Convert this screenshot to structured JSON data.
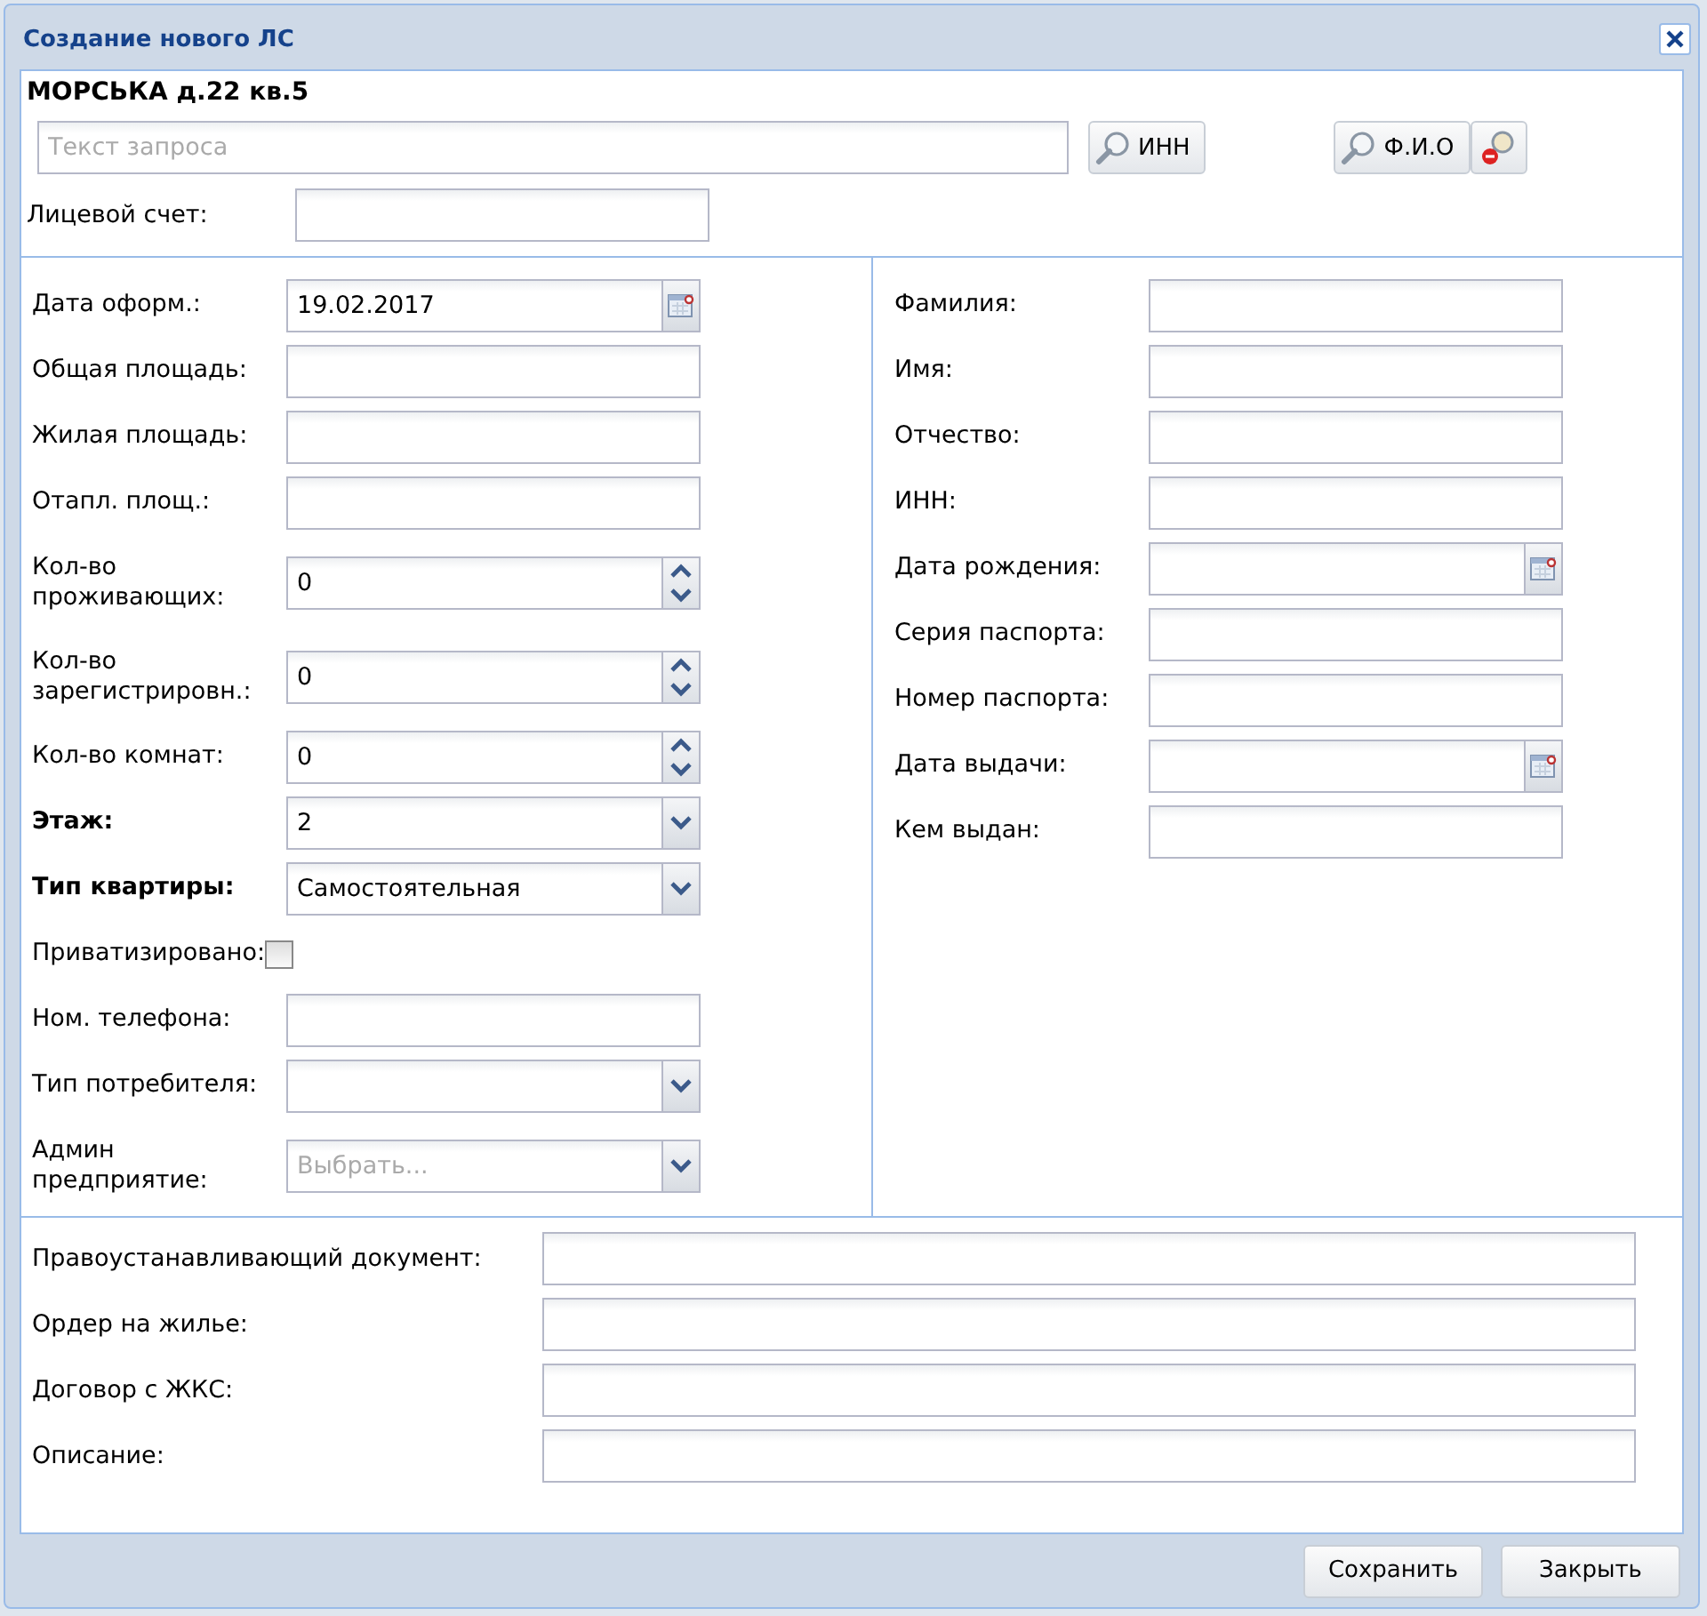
{
  "window": {
    "title": "Создание нового ЛС"
  },
  "address": "МОРСЬКА д.22 кв.5",
  "search": {
    "placeholder": "Текст запроса",
    "buttons": [
      {
        "label": "ИНН"
      },
      {
        "label": "Ф.И.О"
      }
    ]
  },
  "account": {
    "label": "Лицевой счет:"
  },
  "left_fields": [
    {
      "kind": "date",
      "label": "Дата оформ.:",
      "value": "19.02.2017",
      "required": false
    },
    {
      "kind": "text",
      "label": "Общая площадь:",
      "required": false
    },
    {
      "kind": "text",
      "label": "Жилая площадь:",
      "required": false
    },
    {
      "kind": "text",
      "label": "Отапл. площ.:",
      "required": false
    },
    {
      "kind": "spinner",
      "label": "Кол-во проживающих:",
      "value": "0",
      "required": false
    },
    {
      "kind": "spinner",
      "label": "Кол-во зарегистрировн.:",
      "value": "0",
      "required": false
    },
    {
      "kind": "spinner",
      "label": "Кол-во комнат:",
      "value": "0",
      "required": false
    },
    {
      "kind": "combo",
      "label": "Этаж:",
      "value": "2",
      "required": true
    },
    {
      "kind": "combo",
      "label": "Тип квартиры:",
      "value": "Самостоятельная",
      "required": true
    },
    {
      "kind": "checkbox",
      "label": "Приватизировано:",
      "checked": false,
      "required": false
    },
    {
      "kind": "text",
      "label": "Ном. телефона:",
      "required": false
    },
    {
      "kind": "combo",
      "label": "Тип потребителя:",
      "required": false
    },
    {
      "kind": "combo",
      "label": "Админ предприятие:",
      "placeholder": "Выбрать...",
      "required": false
    }
  ],
  "right_fields": [
    {
      "kind": "text",
      "label": "Фамилия:"
    },
    {
      "kind": "text",
      "label": "Имя:"
    },
    {
      "kind": "text",
      "label": "Отчество:"
    },
    {
      "kind": "text",
      "label": "ИНН:"
    },
    {
      "kind": "date",
      "label": "Дата рождения:"
    },
    {
      "kind": "text",
      "label": "Серия паспорта:"
    },
    {
      "kind": "text",
      "label": "Номер паспорта:"
    },
    {
      "kind": "date",
      "label": "Дата выдачи:"
    },
    {
      "kind": "text",
      "label": "Кем выдан:"
    }
  ],
  "document_fields": [
    {
      "label": "Правоустанавливающий документ:"
    },
    {
      "label": "Ордер на жилье:"
    },
    {
      "label": "Договор с ЖКС:"
    },
    {
      "label": "Описание:"
    }
  ],
  "buttons": [
    {
      "label": "Сохранить"
    },
    {
      "label": "Закрыть"
    }
  ]
}
